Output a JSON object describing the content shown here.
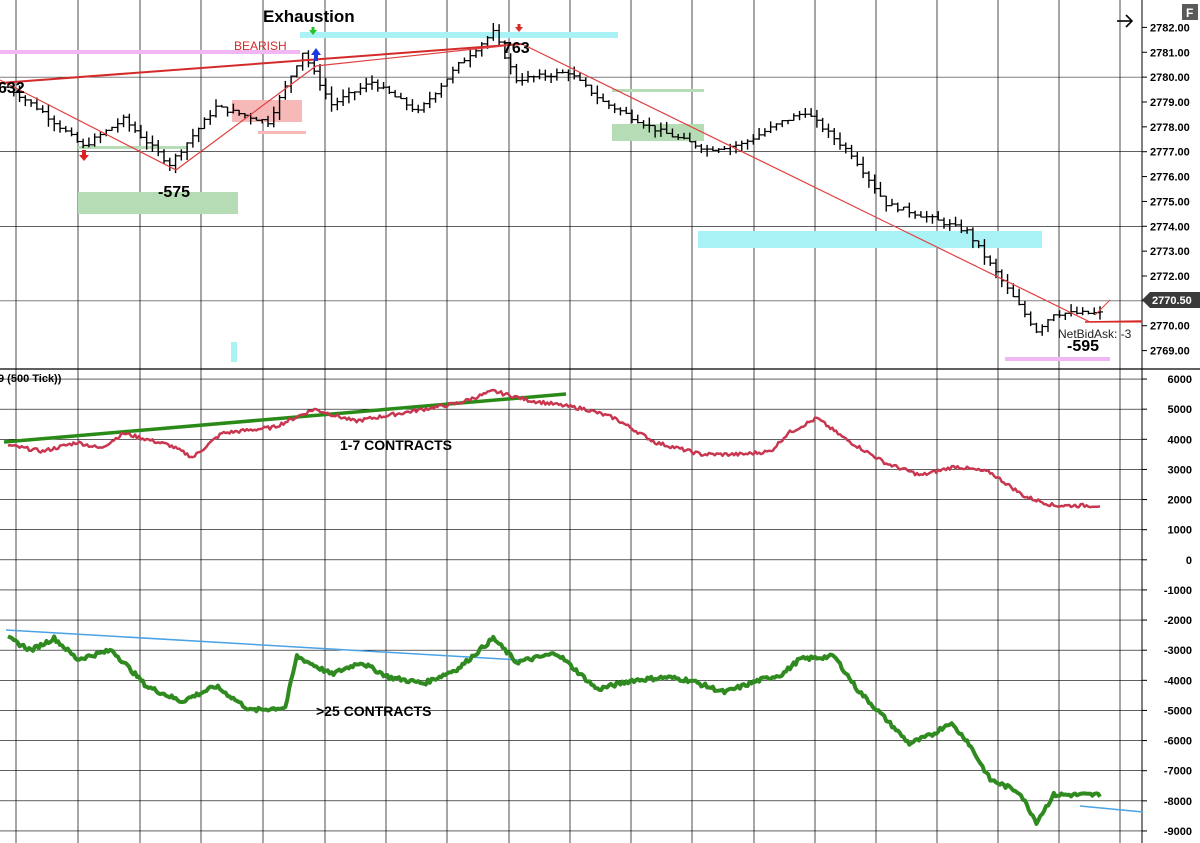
{
  "header": {
    "title": "Exhaustion",
    "corner_button": "F",
    "scroll_icon": "arrow-right-icon"
  },
  "price_panel": {
    "ylim": [
      2768.3,
      2782.7
    ],
    "y_ticks": [
      "2782.00",
      "2781.00",
      "2780.00",
      "2779.00",
      "2778.00",
      "2777.00",
      "2776.00",
      "2775.00",
      "2774.00",
      "2773.00",
      "2772.00",
      "2771.00",
      "2770.00",
      "2769.00"
    ],
    "current_price": "2770.50",
    "signal_label": "BEARISH",
    "swing_labels": [
      "632",
      "-575",
      "763",
      "-595"
    ],
    "netbidask_label": "NetBidAsk: -3"
  },
  "indicator_panel": {
    "title": "9 (500 Tick))",
    "ylim": [
      -9300,
      6300
    ],
    "y_ticks": [
      "6000",
      "5000",
      "4000",
      "3000",
      "2000",
      "1000",
      "0",
      "-1000",
      "-2000",
      "-3000",
      "-4000",
      "-5000",
      "-6000",
      "-7000",
      "-8000",
      "-9000"
    ],
    "series_small_label": "1-7 CONTRACTS",
    "series_large_label": ">25 CONTRACTS"
  },
  "colors": {
    "price_bar": "#000000",
    "trend_red": "#d42a2a",
    "small_line": "#c8374f",
    "large_line": "#2f8a1f",
    "trend_green": "#2a8a18",
    "trend_blue": "#4aa3e6",
    "zone_green": "#b5dcb5",
    "zone_red": "#f7b8b8",
    "zone_cyan": "#a9f2f6",
    "zone_magenta": "#f2b6f2",
    "grid": "#000000"
  },
  "chart_data": {
    "type": "line",
    "x_count": 190,
    "price": {
      "anchors": [
        [
          0,
          2779.6
        ],
        [
          6,
          2778.6
        ],
        [
          13,
          2777.2
        ],
        [
          20,
          2778.3
        ],
        [
          28,
          2776.5
        ],
        [
          36,
          2778.8
        ],
        [
          45,
          2778.2
        ],
        [
          51,
          2781.0
        ],
        [
          56,
          2778.9
        ],
        [
          63,
          2779.8
        ],
        [
          71,
          2778.6
        ],
        [
          78,
          2780.5
        ],
        [
          84,
          2781.8
        ],
        [
          88,
          2779.9
        ],
        [
          97,
          2780.2
        ],
        [
          103,
          2779.0
        ],
        [
          112,
          2777.9
        ],
        [
          121,
          2777.1
        ],
        [
          127,
          2777.3
        ],
        [
          134,
          2778.2
        ],
        [
          138,
          2778.6
        ],
        [
          146,
          2776.9
        ],
        [
          152,
          2774.9
        ],
        [
          160,
          2774.3
        ],
        [
          166,
          2773.8
        ],
        [
          172,
          2771.8
        ],
        [
          178,
          2769.8
        ],
        [
          181,
          2770.5
        ]
      ],
      "amp": 0.32
    },
    "series": [
      {
        "name": "1-7 CONTRACTS",
        "anchors": [
          [
            0,
            3800
          ],
          [
            6,
            3600
          ],
          [
            12,
            3900
          ],
          [
            16,
            3700
          ],
          [
            20,
            4200
          ],
          [
            28,
            3800
          ],
          [
            32,
            3400
          ],
          [
            37,
            4200
          ],
          [
            46,
            4400
          ],
          [
            53,
            5000
          ],
          [
            60,
            4600
          ],
          [
            69,
            4900
          ],
          [
            78,
            5200
          ],
          [
            84,
            5600
          ],
          [
            90,
            5300
          ],
          [
            100,
            5000
          ],
          [
            105,
            4700
          ],
          [
            112,
            3900
          ],
          [
            120,
            3500
          ],
          [
            127,
            3500
          ],
          [
            132,
            3600
          ],
          [
            135,
            4200
          ],
          [
            140,
            4700
          ],
          [
            145,
            4000
          ],
          [
            152,
            3200
          ],
          [
            158,
            2800
          ],
          [
            164,
            3100
          ],
          [
            170,
            2900
          ],
          [
            176,
            2100
          ],
          [
            181,
            1800
          ]
        ],
        "amp": 120
      },
      {
        "name": ">25 CONTRACTS",
        "anchors": [
          [
            0,
            -2600
          ],
          [
            4,
            -3000
          ],
          [
            8,
            -2600
          ],
          [
            12,
            -3300
          ],
          [
            18,
            -3000
          ],
          [
            24,
            -4200
          ],
          [
            30,
            -4700
          ],
          [
            36,
            -4200
          ],
          [
            42,
            -5000
          ],
          [
            48,
            -4900
          ],
          [
            50,
            -3200
          ],
          [
            56,
            -3800
          ],
          [
            61,
            -3400
          ],
          [
            66,
            -3900
          ],
          [
            72,
            -4100
          ],
          [
            78,
            -3600
          ],
          [
            84,
            -2600
          ],
          [
            88,
            -3400
          ],
          [
            95,
            -3100
          ],
          [
            102,
            -4300
          ],
          [
            108,
            -4000
          ],
          [
            114,
            -3900
          ],
          [
            118,
            -4000
          ],
          [
            124,
            -4400
          ],
          [
            130,
            -4000
          ],
          [
            134,
            -3800
          ],
          [
            137,
            -3300
          ],
          [
            143,
            -3200
          ],
          [
            147,
            -4300
          ],
          [
            152,
            -5300
          ],
          [
            156,
            -6100
          ],
          [
            160,
            -5800
          ],
          [
            163,
            -5400
          ],
          [
            166,
            -6000
          ],
          [
            170,
            -7300
          ],
          [
            175,
            -7700
          ],
          [
            178,
            -8700
          ],
          [
            181,
            -7800
          ]
        ],
        "amp": 140
      }
    ]
  }
}
